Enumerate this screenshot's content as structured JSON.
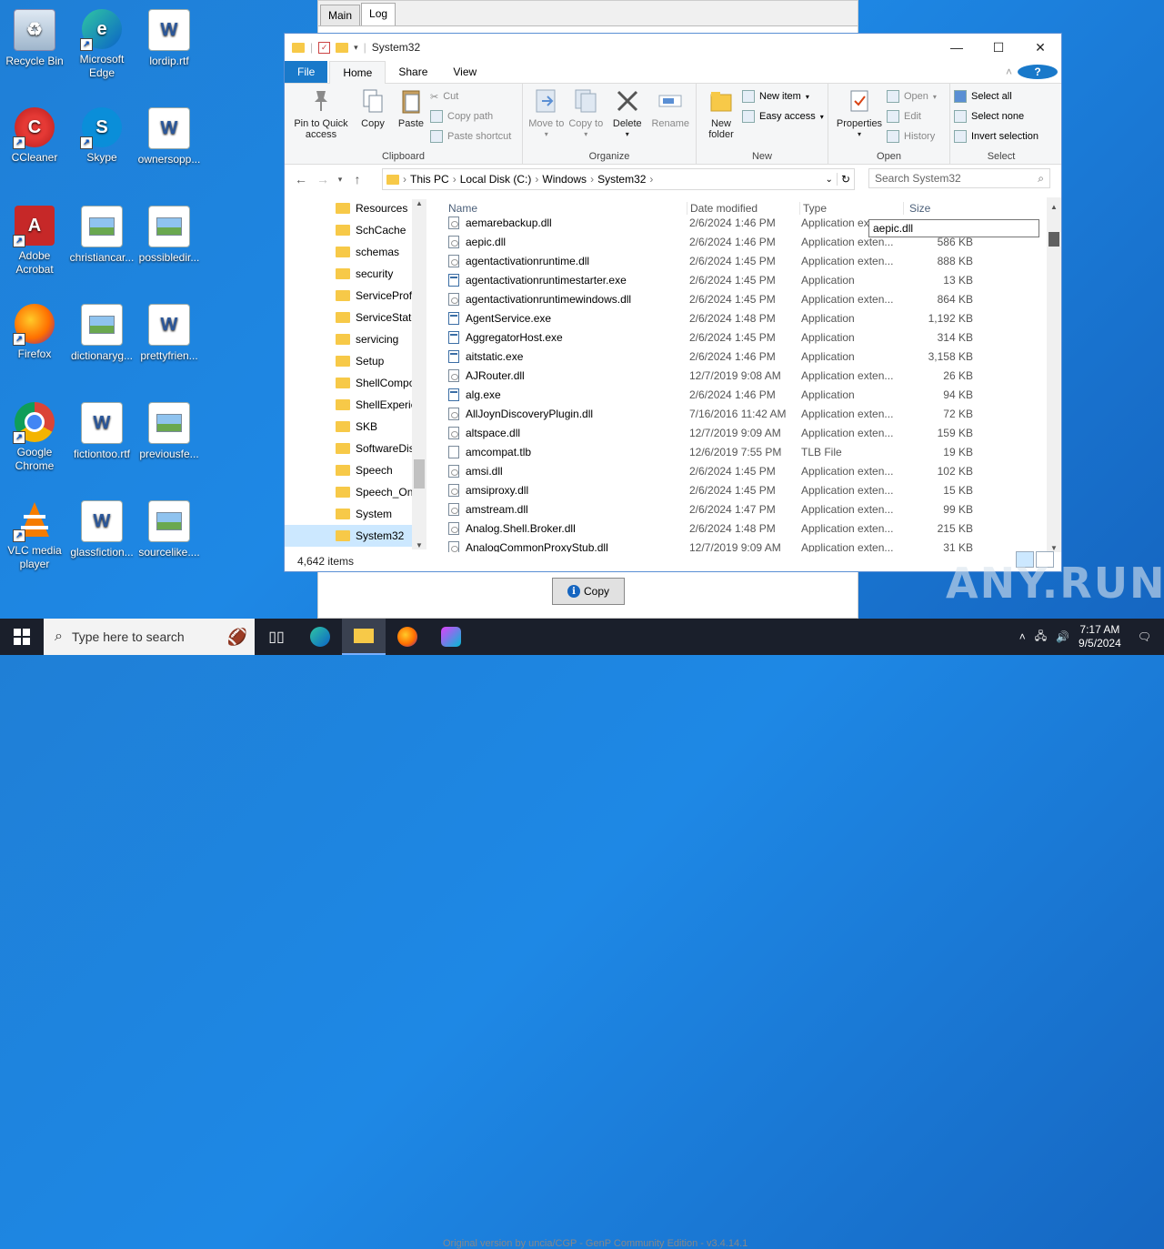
{
  "desktop": {
    "icons": [
      {
        "label": "Recycle Bin"
      },
      {
        "label": "Microsoft Edge"
      },
      {
        "label": "lordip.rtf"
      },
      {
        "label": "CCleaner"
      },
      {
        "label": "Skype"
      },
      {
        "label": "ownersopp..."
      },
      {
        "label": "Adobe Acrobat"
      },
      {
        "label": "christiancar..."
      },
      {
        "label": "possibledir..."
      },
      {
        "label": "Firefox"
      },
      {
        "label": "dictionaryg..."
      },
      {
        "label": "prettyfrien..."
      },
      {
        "label": "Google Chrome"
      },
      {
        "label": "fictiontoo.rtf"
      },
      {
        "label": "previousfe..."
      },
      {
        "label": "VLC media player"
      },
      {
        "label": "glassfiction..."
      },
      {
        "label": "sourcelike...."
      }
    ]
  },
  "backapp": {
    "tabs": [
      "Main",
      "Log"
    ],
    "copy_button": "Copy",
    "footer_text": "Original version by uncia/CGP - GenP Community Edition - v3.4.14.1"
  },
  "explorer": {
    "title": "System32",
    "window_controls": {
      "minimize": "—",
      "maximize": "☐",
      "close": "✕"
    },
    "ribbon_tabs": [
      "File",
      "Home",
      "Share",
      "View"
    ],
    "ribbon": {
      "clipboard": {
        "pin": "Pin to Quick access",
        "copy": "Copy",
        "paste": "Paste",
        "cut": "Cut",
        "copy_path": "Copy path",
        "paste_shortcut": "Paste shortcut",
        "label": "Clipboard"
      },
      "organize": {
        "move_to": "Move to",
        "copy_to": "Copy to",
        "delete": "Delete",
        "rename": "Rename",
        "label": "Organize"
      },
      "new": {
        "new_folder": "New folder",
        "new_item": "New item",
        "easy_access": "Easy access",
        "label": "New"
      },
      "open": {
        "properties": "Properties",
        "open": "Open",
        "edit": "Edit",
        "history": "History",
        "label": "Open"
      },
      "select": {
        "select_all": "Select all",
        "select_none": "Select none",
        "invert": "Invert selection",
        "label": "Select"
      }
    },
    "address": {
      "parts": [
        "This PC",
        "Local Disk (C:)",
        "Windows",
        "System32"
      ]
    },
    "search_placeholder": "Search System32",
    "nav_items": [
      "Resources",
      "SchCache",
      "schemas",
      "security",
      "ServiceProfi",
      "ServiceState",
      "servicing",
      "Setup",
      "ShellCompo",
      "ShellExperie",
      "SKB",
      "SoftwareDis",
      "Speech",
      "Speech_One",
      "System",
      "System32"
    ],
    "columns": {
      "name": "Name",
      "date": "Date modified",
      "type": "Type",
      "size": "Size"
    },
    "files": [
      {
        "name": "aemarebackup.dll",
        "date": "2/6/2024 1:46 PM",
        "type": "Application exten...",
        "size": "",
        "kind": "dll"
      },
      {
        "name": "aepic.dll",
        "date": "2/6/2024 1:46 PM",
        "type": "Application exten...",
        "size": "586 KB",
        "kind": "dll"
      },
      {
        "name": "agentactivationruntime.dll",
        "date": "2/6/2024 1:45 PM",
        "type": "Application exten...",
        "size": "888 KB",
        "kind": "dll"
      },
      {
        "name": "agentactivationruntimestarter.exe",
        "date": "2/6/2024 1:45 PM",
        "type": "Application",
        "size": "13 KB",
        "kind": "exe"
      },
      {
        "name": "agentactivationruntimewindows.dll",
        "date": "2/6/2024 1:45 PM",
        "type": "Application exten...",
        "size": "864 KB",
        "kind": "dll"
      },
      {
        "name": "AgentService.exe",
        "date": "2/6/2024 1:48 PM",
        "type": "Application",
        "size": "1,192 KB",
        "kind": "exe"
      },
      {
        "name": "AggregatorHost.exe",
        "date": "2/6/2024 1:45 PM",
        "type": "Application",
        "size": "314 KB",
        "kind": "exe"
      },
      {
        "name": "aitstatic.exe",
        "date": "2/6/2024 1:46 PM",
        "type": "Application",
        "size": "3,158 KB",
        "kind": "exe"
      },
      {
        "name": "AJRouter.dll",
        "date": "12/7/2019 9:08 AM",
        "type": "Application exten...",
        "size": "26 KB",
        "kind": "dll"
      },
      {
        "name": "alg.exe",
        "date": "2/6/2024 1:46 PM",
        "type": "Application",
        "size": "94 KB",
        "kind": "exe"
      },
      {
        "name": "AllJoynDiscoveryPlugin.dll",
        "date": "7/16/2016 11:42 AM",
        "type": "Application exten...",
        "size": "72 KB",
        "kind": "dll"
      },
      {
        "name": "altspace.dll",
        "date": "12/7/2019 9:09 AM",
        "type": "Application exten...",
        "size": "159 KB",
        "kind": "dll"
      },
      {
        "name": "amcompat.tlb",
        "date": "12/6/2019 7:55 PM",
        "type": "TLB File",
        "size": "19 KB",
        "kind": "tlb"
      },
      {
        "name": "amsi.dll",
        "date": "2/6/2024 1:45 PM",
        "type": "Application exten...",
        "size": "102 KB",
        "kind": "dll"
      },
      {
        "name": "amsiproxy.dll",
        "date": "2/6/2024 1:45 PM",
        "type": "Application exten...",
        "size": "15 KB",
        "kind": "dll"
      },
      {
        "name": "amstream.dll",
        "date": "2/6/2024 1:47 PM",
        "type": "Application exten...",
        "size": "99 KB",
        "kind": "dll"
      },
      {
        "name": "Analog.Shell.Broker.dll",
        "date": "2/6/2024 1:48 PM",
        "type": "Application exten...",
        "size": "215 KB",
        "kind": "dll"
      },
      {
        "name": "AnalogCommonProxyStub.dll",
        "date": "12/7/2019 9:09 AM",
        "type": "Application exten...",
        "size": "31 KB",
        "kind": "dll"
      }
    ],
    "tooltip": "aepic.dll",
    "status": "4,642 items"
  },
  "taskbar": {
    "search_placeholder": "Type here to search",
    "time": "7:17 AM",
    "date": "9/5/2024"
  },
  "watermark": "ANY.RUN"
}
